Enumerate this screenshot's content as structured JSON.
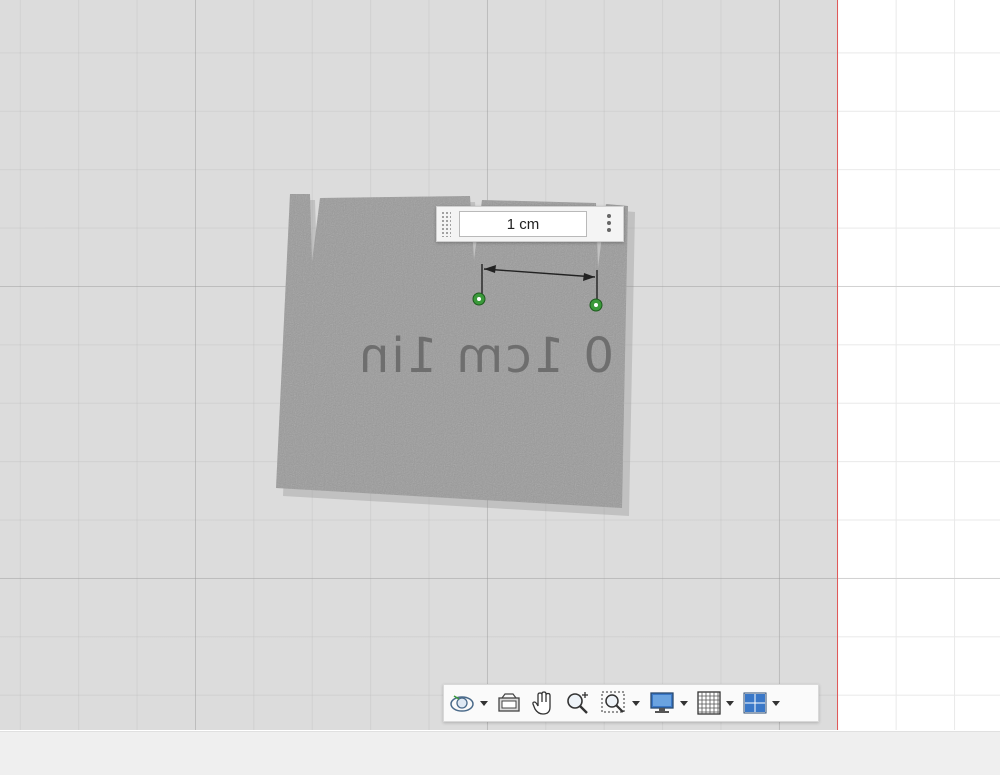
{
  "dimension": {
    "value": "1 cm",
    "menu_icon": "more-vertical-icon",
    "grip_icon": "drag-grip-icon"
  },
  "photo": {
    "engraved_text": "0 1cm 1in",
    "description_icon": "calibration-card-photo"
  },
  "toolbar": {
    "items": [
      {
        "name": "orbit-icon",
        "has_menu": true
      },
      {
        "name": "look-at-icon",
        "has_menu": false
      },
      {
        "name": "pan-icon",
        "has_menu": false
      },
      {
        "name": "zoom-icon",
        "has_menu": false
      },
      {
        "name": "fit-icon",
        "has_menu": true
      },
      {
        "name": "display-settings-icon",
        "has_menu": true
      },
      {
        "name": "grid-settings-icon",
        "has_menu": true
      },
      {
        "name": "viewports-icon",
        "has_menu": true
      }
    ]
  },
  "colors": {
    "accent_red": "#e05a5a",
    "point_green": "#3a9a3a",
    "viewports_blue": "#3a78c8"
  }
}
